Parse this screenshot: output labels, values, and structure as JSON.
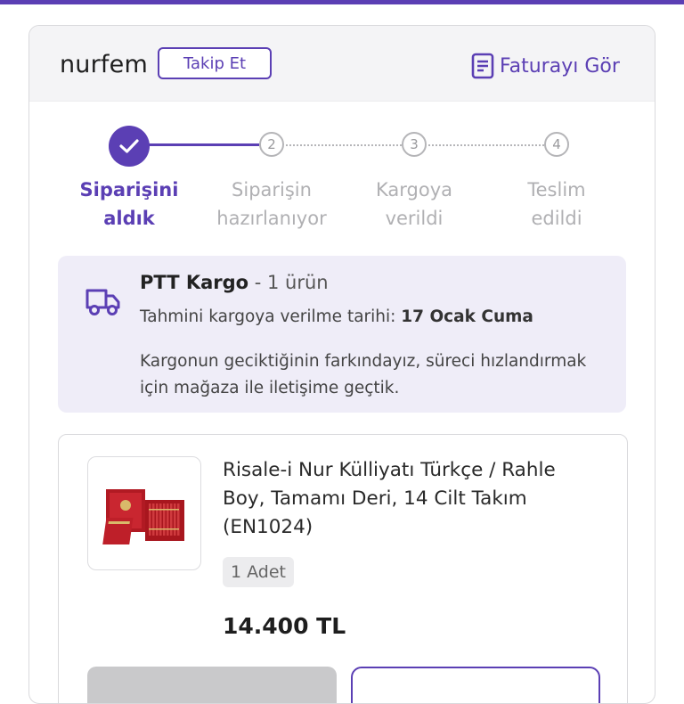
{
  "header": {
    "seller_name": "nurfem",
    "follow_label": "Takip Et",
    "invoice_label": "Faturayı Gör",
    "accent": "#5b3fb4"
  },
  "stepper": {
    "steps": [
      {
        "number": "",
        "label_line1": "Siparişini",
        "label_line2": "aldık",
        "state": "done"
      },
      {
        "number": "2",
        "label_line1": "Siparişin",
        "label_line2": "hazırlanıyor",
        "state": "todo"
      },
      {
        "number": "3",
        "label_line1": "Kargoya",
        "label_line2": "verildi",
        "state": "todo"
      },
      {
        "number": "4",
        "label_line1": "Teslim",
        "label_line2": "edildi",
        "state": "todo"
      }
    ]
  },
  "shipping": {
    "carrier": "PTT Kargo",
    "item_count": " - 1 ürün",
    "eta_label": "Tahmini kargoya verilme tarihi: ",
    "eta_date": "17 Ocak Cuma",
    "delay_note": "Kargonun geciktiğinin farkındayız, süreci hızlandırmak için mağaza ile iletişime geçtik.",
    "icon": "truck-icon"
  },
  "product": {
    "name": "Risale-i Nur Külliyatı Türkçe / Rahle Boy, Tamamı Deri, 14 Cilt Takım (EN1024)",
    "quantity": "1 Adet",
    "price": "14.400 TL"
  }
}
